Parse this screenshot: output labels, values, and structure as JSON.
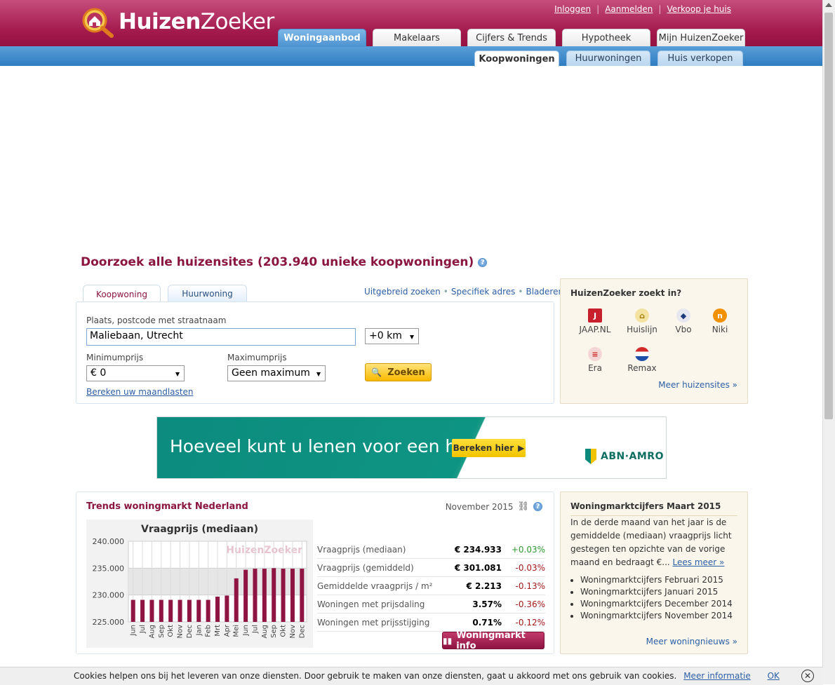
{
  "header": {
    "logo_bold": "Huizen",
    "logo_light": "Zoeker",
    "links": [
      "Inloggen",
      "Aanmelden",
      "Verkoop je huis"
    ],
    "main_tabs": [
      "Woningaanbod",
      "Makelaars",
      "Cijfers & Trends",
      "Hypotheek",
      "Mijn HuizenZoeker"
    ],
    "sub_tabs": [
      "Koopwoningen",
      "Huurwoningen",
      "Huis verkopen"
    ]
  },
  "search": {
    "headline": "Doorzoek alle huizensites (203.940 unieke koopwoningen)",
    "tabs": [
      "Koopwoning",
      "Huurwoning"
    ],
    "links": [
      "Uitgebreid zoeken",
      "Specifiek adres",
      "Bladeren"
    ],
    "place_label": "Plaats, postcode met straatnaam",
    "place_value": "Maliebaan, Utrecht",
    "radius_value": "+0 km",
    "min_label": "Minimumprijs",
    "min_value": "€ 0",
    "max_label": "Maximumprijs",
    "max_value": "Geen maximum",
    "search_button": "Zoeken",
    "monthly_link": "Bereken uw maandlasten"
  },
  "sites_box": {
    "title": "HuizenZoeker zoekt in?",
    "sites": [
      {
        "name": "JAAP.NL",
        "icon": "jaap-icon",
        "color": "#c8202c",
        "glyph": "J"
      },
      {
        "name": "Huislijn",
        "icon": "house-icon",
        "color": "#e3c200",
        "glyph": "⌂"
      },
      {
        "name": "Vbo",
        "icon": "vbo-icon",
        "color": "#1d3d7a",
        "glyph": "◆"
      },
      {
        "name": "Niki",
        "icon": "niki-icon",
        "color": "#f29100",
        "glyph": "n"
      },
      {
        "name": "Era",
        "icon": "era-icon",
        "color": "#d22a2a",
        "glyph": "≡"
      },
      {
        "name": "Remax",
        "icon": "remax-balloon-icon",
        "color": "#1f4fa8",
        "glyph": "●"
      }
    ],
    "more_link": "Meer huizensites »"
  },
  "banner": {
    "text": "Hoeveel kunt u lenen voor een huis?",
    "button": "Bereken hier",
    "logo": "ABN·AMRO"
  },
  "trends": {
    "title": "Trends woningmarkt Nederland",
    "date": "November 2015",
    "stats": [
      {
        "label": "Vraagprijs (mediaan)",
        "value": "€ 234.933",
        "change": "+0.03%",
        "dir": "up"
      },
      {
        "label": "Vraagprijs (gemiddeld)",
        "value": "€ 301.081",
        "change": "-0.03%",
        "dir": "down"
      },
      {
        "label": "Gemiddelde vraagprijs / m²",
        "value": "€ 2.213",
        "change": "-0.13%",
        "dir": "down"
      },
      {
        "label": "Woningen met prijsdaling",
        "value": "3.57%",
        "change": "-0.36%",
        "dir": "down"
      },
      {
        "label": "Woningen met prijsstijging",
        "value": "0.71%",
        "change": "-0.12%",
        "dir": "down"
      }
    ],
    "button": "Woningmarkt info"
  },
  "chart_data": {
    "type": "bar",
    "title": "Vraagprijs (mediaan)",
    "watermark": "HuizenZoeker",
    "categories": [
      "Jun",
      "Jul",
      "Aug",
      "Sep",
      "Okt",
      "Nov",
      "Dec",
      "Jan",
      "Feb",
      "Mrt",
      "Apr",
      "Mei",
      "Jun",
      "Jul",
      "Aug",
      "Sep",
      "Okt",
      "Nov",
      "Dec"
    ],
    "values": [
      229.1,
      229.1,
      229.1,
      229.1,
      229.1,
      229.1,
      229.1,
      229.1,
      229.1,
      229.7,
      229.9,
      233.1,
      234.7,
      234.9,
      234.9,
      235.0,
      234.9,
      234.9,
      234.9
    ],
    "yticks": [
      "240.000",
      "235.000",
      "230.000",
      "225.000"
    ],
    "ylim": [
      225,
      240
    ],
    "color": "#8e1442"
  },
  "market_box": {
    "title": "Woningmarktcijfers Maart 2015",
    "text": "In de derde maand van het jaar is de gemiddelde (mediaan) vraagprijs licht gestegen ten opzichte van de vorige maand en bedraagt €...",
    "read_more": "Lees meer »",
    "items": [
      "Woningmarktcijfers Februari 2015",
      "Woningmarktcijfers Januari 2015",
      "Woningmarktcijfers December 2014",
      "Woningmarktcijfers November 2014"
    ],
    "more_link": "Meer woningnieuws »"
  },
  "cookie": {
    "text": "Cookies helpen ons bij het leveren van onze diensten. Door gebruik te maken van onze diensten, gaat u akkoord met ons gebruik van cookies.",
    "more": "Meer informatie",
    "ok": "OK"
  },
  "colors": {
    "brand": "#a2184b",
    "blue": "#2f7cc1",
    "up": "#2e9a2e",
    "down": "#a31b1b"
  }
}
